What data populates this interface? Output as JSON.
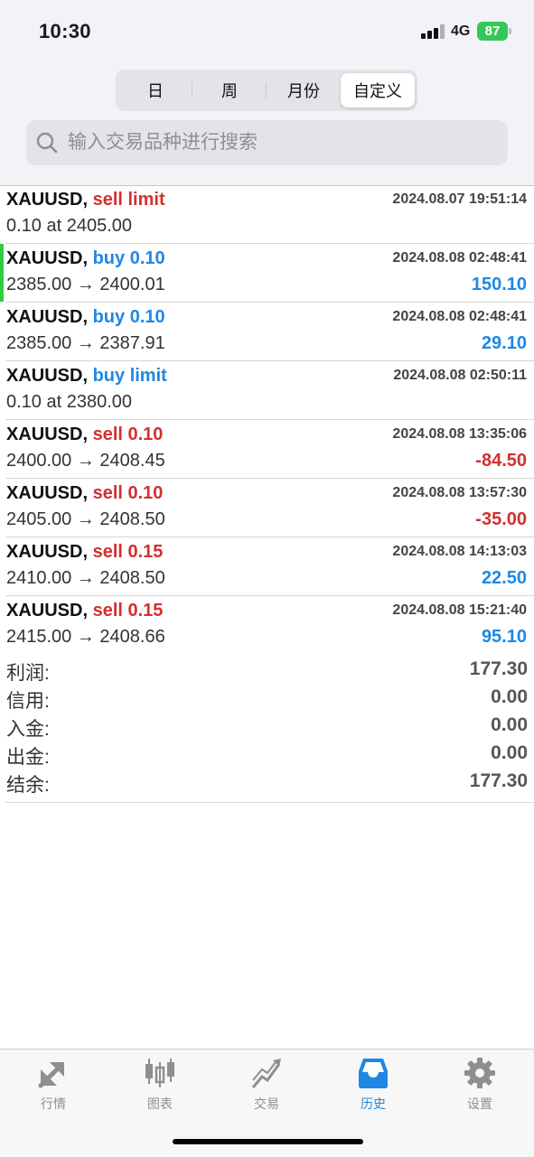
{
  "status": {
    "time": "10:30",
    "network": "4G",
    "battery": "87"
  },
  "segment": {
    "items": [
      "日",
      "周",
      "月份",
      "自定义"
    ],
    "active": 3
  },
  "search": {
    "placeholder": "输入交易品种进行搜索"
  },
  "orders": [
    {
      "symbol": "XAUUSD,",
      "action": "sell limit",
      "action_type": "sell",
      "datetime": "2024.08.07 19:51:14",
      "detail": "0.10 at 2405.00",
      "profit": ""
    },
    {
      "symbol": "XAUUSD,",
      "action": "buy 0.10",
      "action_type": "buy",
      "datetime": "2024.08.08 02:48:41",
      "detail": "2385.00 → 2400.01",
      "profit": "150.10"
    },
    {
      "symbol": "XAUUSD,",
      "action": "buy 0.10",
      "action_type": "buy",
      "datetime": "2024.08.08 02:48:41",
      "detail": "2385.00 → 2387.91",
      "profit": "29.10"
    },
    {
      "symbol": "XAUUSD,",
      "action": "buy limit",
      "action_type": "buy",
      "datetime": "2024.08.08 02:50:11",
      "detail": "0.10 at 2380.00",
      "profit": ""
    },
    {
      "symbol": "XAUUSD,",
      "action": "sell 0.10",
      "action_type": "sell",
      "datetime": "2024.08.08 13:35:06",
      "detail": "2400.00 → 2408.45",
      "profit": "-84.50"
    },
    {
      "symbol": "XAUUSD,",
      "action": "sell 0.10",
      "action_type": "sell",
      "datetime": "2024.08.08 13:57:30",
      "detail": "2405.00 → 2408.50",
      "profit": "-35.00"
    },
    {
      "symbol": "XAUUSD,",
      "action": "sell 0.15",
      "action_type": "sell",
      "datetime": "2024.08.08 14:13:03",
      "detail": "2410.00 → 2408.50",
      "profit": "22.50"
    },
    {
      "symbol": "XAUUSD,",
      "action": "sell 0.15",
      "action_type": "sell",
      "datetime": "2024.08.08 15:21:40",
      "detail": "2415.00 → 2408.66",
      "profit": "95.10"
    }
  ],
  "summary": [
    {
      "label": "利润:",
      "value": "177.30"
    },
    {
      "label": "信用:",
      "value": "0.00"
    },
    {
      "label": "入金:",
      "value": "0.00"
    },
    {
      "label": "出金:",
      "value": "0.00"
    },
    {
      "label": "结余:",
      "value": "177.30"
    }
  ],
  "tabbar": {
    "items": [
      {
        "label": "行情",
        "icon": "quotes-arrows-icon"
      },
      {
        "label": "图表",
        "icon": "candlestick-chart-icon"
      },
      {
        "label": "交易",
        "icon": "trade-chart-icon"
      },
      {
        "label": "历史",
        "icon": "history-inbox-icon"
      },
      {
        "label": "设置",
        "icon": "gear-icon"
      }
    ],
    "active": 3
  },
  "colors": {
    "buy": "#1e88e5",
    "sell": "#d32f2f",
    "active_tab": "#1e88e5",
    "battery": "#34c759",
    "selected_marker": "#2ecc40"
  }
}
